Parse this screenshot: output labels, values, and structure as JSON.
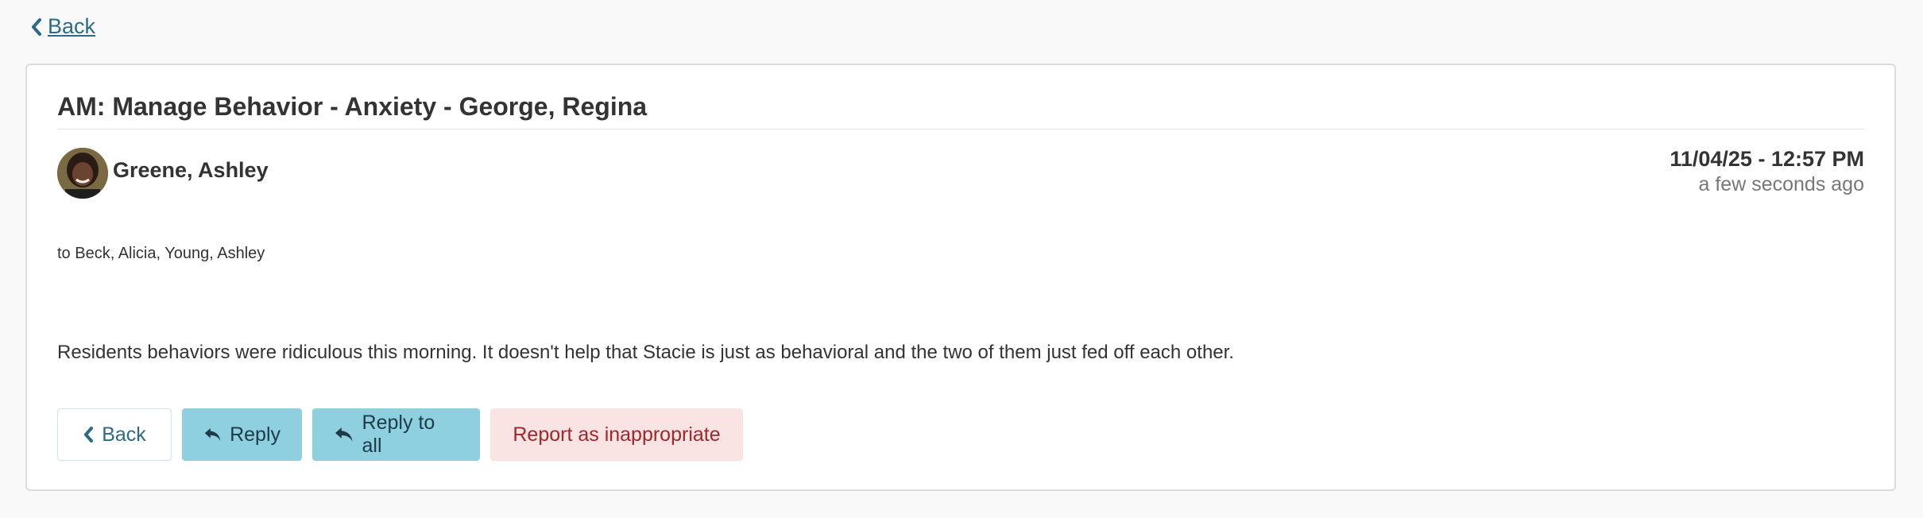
{
  "nav": {
    "back_label": "Back"
  },
  "message": {
    "subject": "AM: Manage Behavior - Anxiety - George, Regina",
    "sender": "Greene, Ashley",
    "date": "11/04/25 - 12:57 PM",
    "relative_time": "a few seconds ago",
    "recipients": "to Beck, Alicia, Young, Ashley",
    "body": "Residents behaviors were ridiculous this morning. It doesn't help that Stacie is just as behavioral and the two of them just fed off each other."
  },
  "actions": {
    "back_label": "Back",
    "reply_label": "Reply",
    "reply_all_label": "Reply to all",
    "report_label": "Report as inappropriate"
  },
  "icons": {
    "back": "chevron-left-icon",
    "reply": "reply-icon",
    "reply_all": "reply-icon"
  },
  "colors": {
    "link": "#2b6b85",
    "reply_button": "#8ecfe0",
    "report_button_bg": "#f9e3e3",
    "report_button_text": "#a3262b"
  }
}
